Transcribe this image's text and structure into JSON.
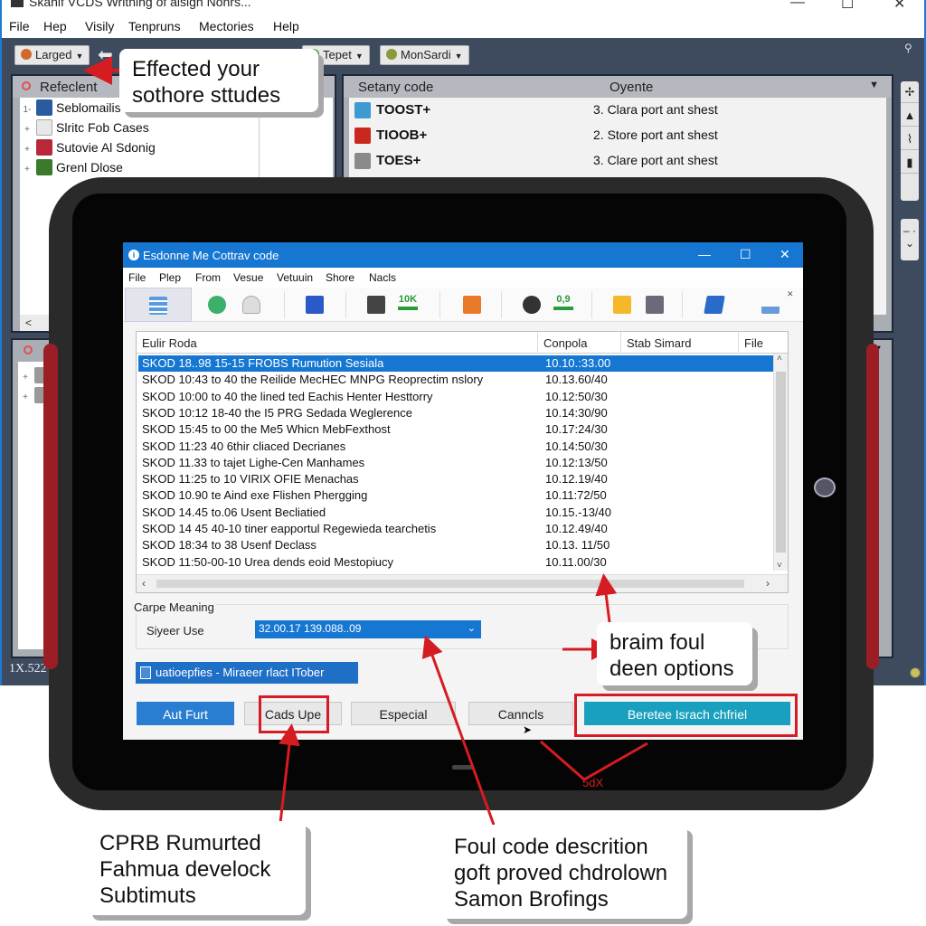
{
  "background_app": {
    "title": "Skanif VCDS Writhing of aisign Nonrs...",
    "window_controls": {
      "minimize": "—",
      "maximize": "☐",
      "close": "✕"
    },
    "menu": [
      "File",
      "Hep",
      "Visily",
      "Tenpruns",
      "Mectories",
      "Help"
    ],
    "toolbar": {
      "larged_label": "Larged",
      "tepet_label": "Tepet",
      "monsardi_label": "MonSardi",
      "pin_icon": "pin-icon"
    },
    "left_pane": {
      "header": "Refeclent",
      "tree": [
        {
          "expander": "1-",
          "label": "Seblomailis"
        },
        {
          "expander": "+",
          "label": "Slritc Fob Cases"
        },
        {
          "expander": "+",
          "label": "Sutovie Al Sdonig"
        },
        {
          "expander": "+",
          "label": "Grenl Dlose"
        }
      ],
      "scroll_left": "<"
    },
    "right_pane": {
      "headers": [
        "Setany code",
        "Oyente"
      ],
      "rows": [
        {
          "code": "TOOST+",
          "description": "3. Clara port ant shest",
          "color": "#3f9ad0"
        },
        {
          "code": "TIOOB+",
          "description": "2. Store port ant shest",
          "color": "#c8281e"
        },
        {
          "code": "TOES+",
          "description": "3. Clare port ant shest",
          "color": "#8a8a8a"
        }
      ]
    },
    "side_tools": [
      "✢",
      "▲",
      "⌇",
      "▮"
    ],
    "side_scroll": "– · ⌄",
    "status_number": "1X.522"
  },
  "dialog": {
    "title": "Esdonne Me Cottrav code",
    "window_controls": {
      "minimize": "—",
      "maximize": "☐",
      "close": "✕"
    },
    "menu": [
      "File",
      "Plep",
      "From",
      "Vesue",
      "Vetuuin",
      "Shore",
      "Nacls"
    ],
    "toolbar": {
      "badge_1": "10K",
      "badge_2": "0,9"
    },
    "table": {
      "headers": [
        "Eulir Roda",
        "Conpola",
        "Stab Simard",
        "File"
      ],
      "rows": [
        {
          "code": "SKOD 18..98 15-15 FROBS Rumution Sesiala",
          "time": "10.10.:33.00",
          "selected": true
        },
        {
          "code": "SKOD 10:43 to 40 the Reilide MecHEC MNPG Reoprectim nslory",
          "time": "10.13.60/40"
        },
        {
          "code": "SKOD 10:00 to 40 the lined ted Eachis Henter Hesttorry",
          "time": "10.12:50/30"
        },
        {
          "code": "SKOD 10:12 18-40 the I5 PRG Sedada Weglerence",
          "time": "10.14:30/90"
        },
        {
          "code": "SKOD 15:45 to 00 the Me5 Whicn MebFexthost",
          "time": "10.17:24/30"
        },
        {
          "code": "SKOD 11:23 40 6thir cliaced Decrianes",
          "time": "10.14:50/30"
        },
        {
          "code": "SKOD 11.33 to tajet Lighe-Cen Manhames",
          "time": "10.12:13/50"
        },
        {
          "code": "SKOD 11:25 to 10 VIRIX OFIE Menachas",
          "time": "10.12.19/40"
        },
        {
          "code": "SKOD 10.90 te Aind exe Flishen Phergging",
          "time": "10.11:72/50"
        },
        {
          "code": "SKOD 14.45 to.06 Usent Becliatied",
          "time": "10.15.-13/40"
        },
        {
          "code": "SKOD 14 45 40-10 tiner eapportul Regewieda tearchetis",
          "time": "10.12.49/40"
        },
        {
          "code": "SKOD 18:34 to 38 Usenf Declass",
          "time": "10.13. 11/50"
        },
        {
          "code": "SKOD 11:50-00-10 Urea dends eoid Mestopiucy",
          "time": "10.11.00/30"
        }
      ],
      "scroll_up": "˄",
      "scroll_down": "˅",
      "scroll_left": "‹",
      "scroll_right": "›"
    },
    "group_label": "Carpe Meaning",
    "field_label": "Siyeer Use",
    "select_value": "32.00.17 139.088..09",
    "status_text": "uatioepfies - Miraeer rlact ITober",
    "buttons": {
      "aut_furt": "Aut Furt",
      "cads_upe": "Cads Upe",
      "especial": "Especial",
      "canncls": "Canncls",
      "beretee": "Beretee Israch chfriel"
    }
  },
  "annotations": {
    "callout_top": [
      "Effected your",
      "sothore sttudes"
    ],
    "callout_right": [
      "braim foul",
      "deen options"
    ],
    "callout_bottom_left": [
      "CPRB Rumurted",
      "Fahmua develock",
      "Subtimuts"
    ],
    "callout_bottom_right": [
      "Foul code descrition",
      "goft proved chdrolown",
      "Samon Brofings"
    ],
    "marker_label": "5dX",
    "arrow_color": "#d41c22"
  }
}
